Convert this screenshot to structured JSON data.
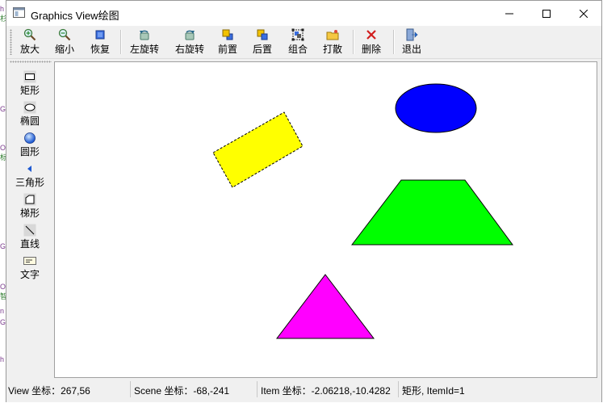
{
  "window": {
    "title": "Graphics  View绘图",
    "minimize_icon": "minimize-icon",
    "maximize_icon": "maximize-icon",
    "close_icon": "close-icon"
  },
  "toolbar": {
    "buttons": [
      {
        "label": "放大",
        "icon": "zoom-in-icon"
      },
      {
        "label": "缩小",
        "icon": "zoom-out-icon"
      },
      {
        "label": "恢复",
        "icon": "restore-icon"
      },
      {
        "label": "左旋转",
        "icon": "rotate-left-icon"
      },
      {
        "label": "右旋转",
        "icon": "rotate-right-icon"
      },
      {
        "label": "前置",
        "icon": "bring-front-icon"
      },
      {
        "label": "后置",
        "icon": "send-back-icon"
      },
      {
        "label": "组合",
        "icon": "group-icon"
      },
      {
        "label": "打散",
        "icon": "ungroup-icon"
      },
      {
        "label": "删除",
        "icon": "delete-icon"
      },
      {
        "label": "退出",
        "icon": "exit-icon"
      }
    ]
  },
  "sidebar": {
    "items": [
      {
        "label": "矩形",
        "icon": "rectangle-icon"
      },
      {
        "label": "椭圆",
        "icon": "ellipse-icon"
      },
      {
        "label": "圆形",
        "icon": "circle-icon"
      },
      {
        "label": "三角形",
        "icon": "triangle-icon"
      },
      {
        "label": "梯形",
        "icon": "trapezoid-icon"
      },
      {
        "label": "直线",
        "icon": "line-icon"
      },
      {
        "label": "文字",
        "icon": "text-icon"
      }
    ]
  },
  "canvas": {
    "shapes": [
      {
        "type": "rectangle",
        "fill": "#ffff00",
        "selected": true,
        "rotation_deg": -25
      },
      {
        "type": "ellipse",
        "fill": "#0000ff"
      },
      {
        "type": "trapezoid",
        "fill": "#00ff00"
      },
      {
        "type": "triangle",
        "fill": "#ff00ff"
      }
    ]
  },
  "statusbar": {
    "view_coord": "View 坐标：267,56",
    "scene_coord": "Scene 坐标：-68,-241",
    "item_coord": "Item 坐标：-2.06218,-10.4282",
    "item_info": "矩形, ItemId=1"
  },
  "colors": {
    "rect_fill": "#ffff00",
    "ellipse_fill": "#0000ff",
    "trapezoid_fill": "#00ff00",
    "triangle_fill": "#ff00ff"
  }
}
